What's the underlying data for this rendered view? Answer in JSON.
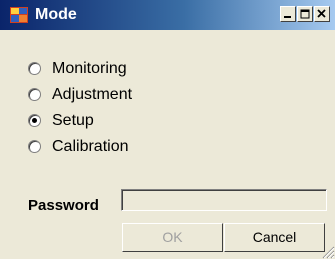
{
  "window": {
    "title": "Mode",
    "title_bar_colors": {
      "start": "#0a246a",
      "end": "#a6caf0"
    }
  },
  "title_buttons": [
    {
      "name": "minimize-button",
      "icon": "minimize-icon"
    },
    {
      "name": "maximize-button",
      "icon": "maximize-icon"
    },
    {
      "name": "close-button",
      "icon": "close-icon"
    }
  ],
  "modes": {
    "selected": "Setup",
    "options": [
      {
        "label": "Monitoring",
        "checked": false
      },
      {
        "label": "Adjustment",
        "checked": false
      },
      {
        "label": "Setup",
        "checked": true
      },
      {
        "label": "Calibration",
        "checked": false
      }
    ]
  },
  "password": {
    "label": "Password",
    "value": "",
    "enabled": false
  },
  "buttons": {
    "ok_label": "OK",
    "ok_enabled": false,
    "cancel_label": "Cancel"
  }
}
